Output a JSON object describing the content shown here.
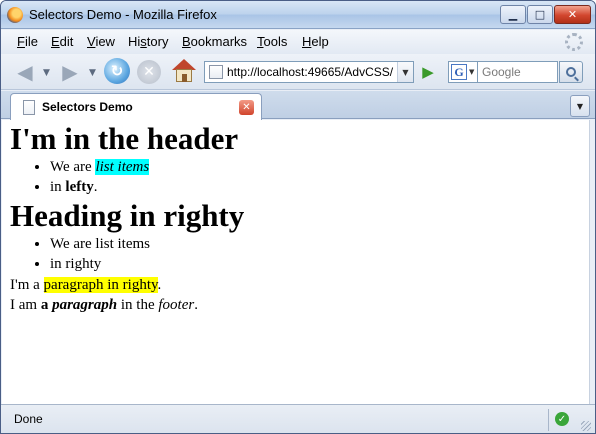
{
  "window": {
    "title": "Selectors Demo - Mozilla Firefox"
  },
  "menubar": {
    "items": [
      {
        "accel": "F",
        "rest": "ile"
      },
      {
        "accel": "E",
        "rest": "dit"
      },
      {
        "accel": "V",
        "rest": "iew"
      },
      {
        "pre": "Hi",
        "accel": "s",
        "rest": "tory"
      },
      {
        "accel": "B",
        "rest": "ookmarks"
      },
      {
        "accel": "T",
        "rest": "ools"
      },
      {
        "accel": "H",
        "rest": "elp"
      }
    ]
  },
  "navbar": {
    "url": "http://localhost:49665/AdvCSS/",
    "search_placeholder": "Google"
  },
  "tabs": [
    {
      "label": "Selectors Demo"
    }
  ],
  "page": {
    "header_heading": "I'm in the header",
    "header_list": {
      "item1_prefix": "We are ",
      "item1_highlight": "list items",
      "item2_prefix": "in ",
      "item2_bold": "lefty",
      "item2_suffix": "."
    },
    "righty_heading": "Heading in righty",
    "righty_list": [
      "We are list items",
      "in righty"
    ],
    "paragraph1": {
      "prefix": "I'm a ",
      "highlight": "paragraph in righty",
      "suffix": "."
    },
    "paragraph2": {
      "prefix": "I am ",
      "bold": "a ",
      "bold_italic": "paragraph",
      "middle": " in the ",
      "italic": "footer",
      "suffix": "."
    }
  },
  "statusbar": {
    "text": "Done"
  },
  "colors": {
    "highlight_cyan": "#00ffff",
    "highlight_yellow": "#ffff00"
  }
}
